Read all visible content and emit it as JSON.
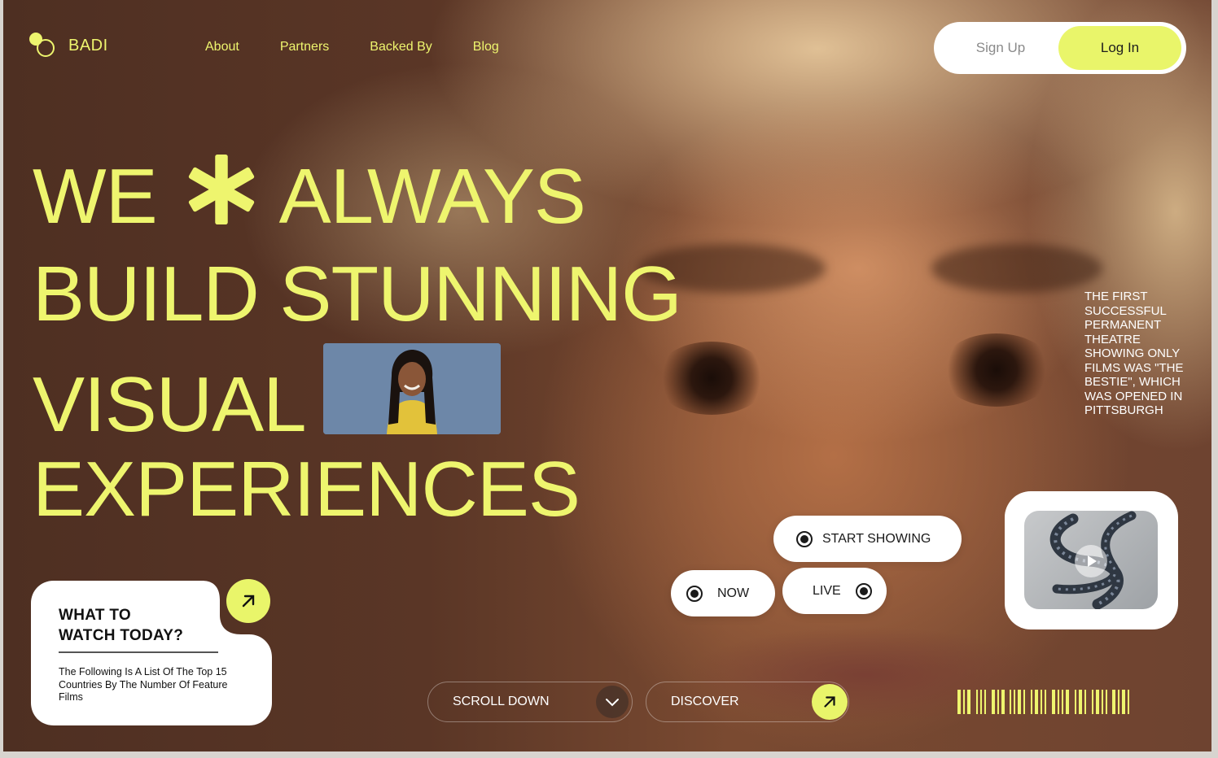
{
  "brand": {
    "name": "BADI",
    "accent": "#eef56e"
  },
  "nav": {
    "items": [
      "About",
      "Partners",
      "Backed By",
      "Blog"
    ]
  },
  "auth": {
    "signup_label": "Sign Up",
    "login_label": "Log In"
  },
  "headline": {
    "line1_a": "WE",
    "line1_b": "ALWAYS",
    "line2": "BUILD STUNNING",
    "line3": "VISUAL",
    "line4": "EXPERIENCES"
  },
  "side_text": "THE FIRST SUCCESSFUL PERMANENT THEATRE SHOWING ONLY FILMS WAS \"THE BESTIE\", WHICH WAS OPENED IN PITTSBURGH",
  "pills": {
    "start_showing": "START SHOWING",
    "now": "NOW",
    "live": "LIVE"
  },
  "watch_card": {
    "title_line1": "WHAT TO",
    "title_line2": "WATCH TODAY?",
    "description": "The Following Is A List Of The Top 15 Countries By The Number Of Feature Films"
  },
  "bottom": {
    "scroll_label": "SCROLL DOWN",
    "discover_label": "DISCOVER"
  },
  "icons": [
    "logo-mark-icon",
    "asterisk-icon",
    "play-icon",
    "arrow-up-right-icon",
    "chevron-down-icon",
    "barcode-icon"
  ]
}
